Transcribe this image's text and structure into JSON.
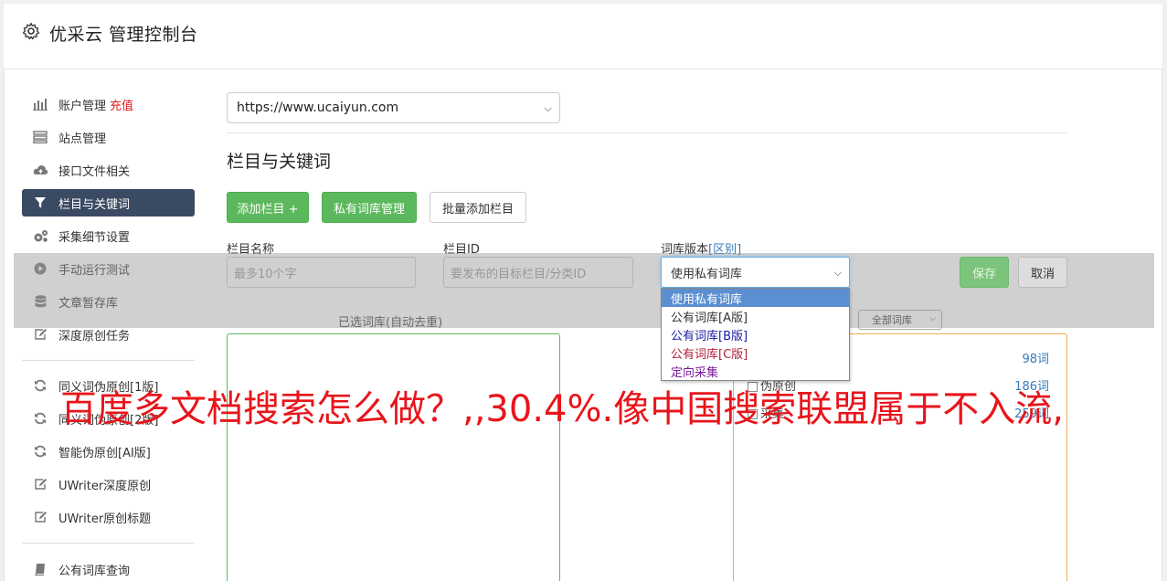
{
  "header": {
    "title": "优采云 管理控制台",
    "icon": "gear-icon"
  },
  "sidebar": {
    "items": [
      {
        "label": "账户管理",
        "extra": "充值",
        "icon": "bar-chart-icon"
      },
      {
        "label": "站点管理",
        "icon": "server-icon"
      },
      {
        "label": "接口文件相关",
        "icon": "cloud-upload-icon"
      },
      {
        "label": "栏目与关键词",
        "icon": "filter-icon",
        "active": true
      },
      {
        "label": "采集细节设置",
        "icon": "cogs-icon"
      },
      {
        "label": "手动运行测试",
        "icon": "play-circle-icon"
      },
      {
        "label": "文章暂存库",
        "icon": "database-icon"
      },
      {
        "label": "深度原创任务",
        "icon": "edit-icon"
      },
      {
        "label": "同义词伪原创[1版]",
        "icon": "refresh-icon"
      },
      {
        "label": "同义词伪原创[2版]",
        "icon": "refresh-icon"
      },
      {
        "label": "智能伪原创[AI版]",
        "icon": "refresh-icon"
      },
      {
        "label": "UWriter深度原创",
        "icon": "edit-icon"
      },
      {
        "label": "UWriter原创标题",
        "icon": "edit-icon"
      },
      {
        "label": "公有词库查询",
        "icon": "book-icon"
      }
    ]
  },
  "main": {
    "site_select": "https://www.ucaiyun.com",
    "section_title": "栏目与关键词",
    "buttons": {
      "add_column": "添加栏目 +",
      "private_lib": "私有词库管理",
      "batch_add": "批量添加栏目"
    },
    "form": {
      "name_label": "栏目名称",
      "name_placeholder": "最多10个字",
      "id_label": "栏目ID",
      "id_placeholder": "要发布的目标栏目/分类ID",
      "version_label": "词库版本",
      "version_link": "[区别]",
      "version_value": "使用私有词库",
      "save": "保存",
      "cancel": "取消"
    },
    "dropdown_options": [
      {
        "label": "使用私有词库",
        "color": "#ffffff",
        "selected": true
      },
      {
        "label": "公有词库[A版]",
        "color": "#333333"
      },
      {
        "label": "公有词库[B版]",
        "color": "#1a1aa6"
      },
      {
        "label": "公有词库[C版]",
        "color": "#b0203a"
      },
      {
        "label": "定向采集",
        "color": "#7a1a9a"
      }
    ],
    "selected_lib_label": "已选词库(自动去重)",
    "all_lib_select": "全部词库",
    "lib_rows": [
      {
        "name": "",
        "count": "98词"
      },
      {
        "name": "伪原创",
        "count": "186词"
      },
      {
        "name": "采集",
        "count": "259词"
      }
    ]
  },
  "watermark": "百度多文档搜索怎么做？,,30.4%.像中国搜索联盟属于不入流,"
}
